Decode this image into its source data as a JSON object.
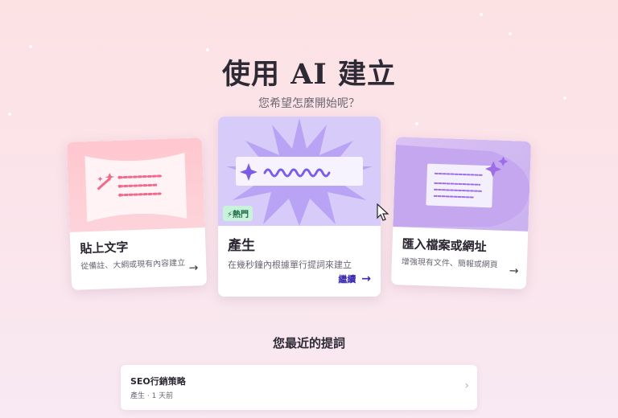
{
  "header": {
    "title": "使用 AI 建立",
    "subtitle": "您希望怎麼開始呢？"
  },
  "cards": {
    "paste": {
      "title": "貼上文字",
      "description": "從備註、大綱或現有內容建立",
      "icon": "arrow-right-icon"
    },
    "generate": {
      "badge": "熱門",
      "title": "產生",
      "description": "在幾秒鐘內根據單行提詞來建立",
      "action": "繼續"
    },
    "import": {
      "title": "匯入檔案或網址",
      "description": "增強現有文件、簡報或網頁",
      "icon": "arrow-right-icon"
    }
  },
  "recent": {
    "title": "您最近的提詞",
    "items": [
      {
        "title": "SEO行銷策略",
        "meta": "產生 · 1 天前"
      }
    ]
  },
  "colors": {
    "accent": "#3b2ab0",
    "badge_bg": "#c9f2dc",
    "generate_bg": "#d7cbf9",
    "paste_bg": "#ffc7cf",
    "import_bg": "#d1b9f2"
  }
}
